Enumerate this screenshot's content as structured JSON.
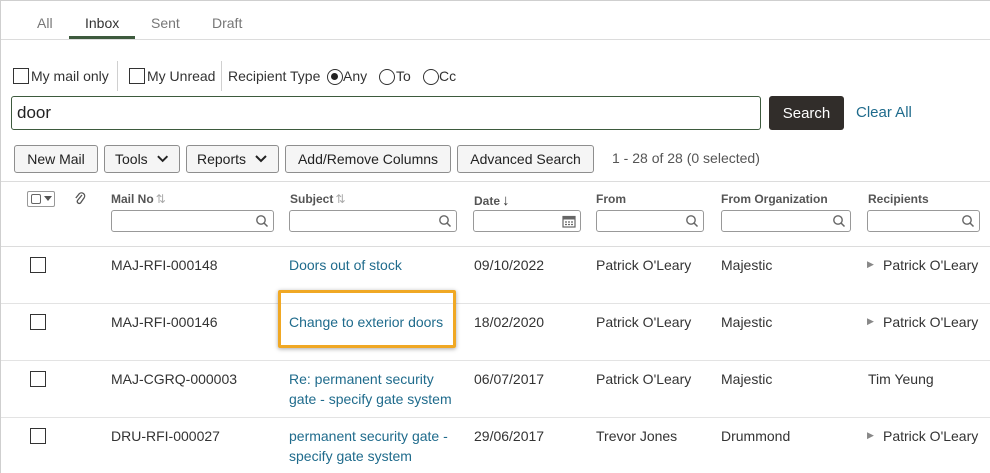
{
  "tabs": [
    "All",
    "Inbox",
    "Sent",
    "Draft"
  ],
  "filters": {
    "my_mail_only": "My mail only",
    "my_unread": "My Unread",
    "recipient_type": "Recipient Type",
    "any": "Any",
    "to": "To",
    "cc": "Cc",
    "selected_recipient": "Any"
  },
  "search": {
    "value": "door",
    "button": "Search",
    "clear_all": "Clear All"
  },
  "toolbar": {
    "new_mail": "New Mail",
    "tools": "Tools",
    "reports": "Reports",
    "add_remove_columns": "Add/Remove Columns",
    "advanced_search": "Advanced Search",
    "result_count": "1 - 28 of 28 (0 selected)"
  },
  "columns": {
    "mail_no": "Mail No",
    "subject": "Subject",
    "date": "Date",
    "from": "From",
    "from_org": "From Organization",
    "recipients": "Recipients"
  },
  "rows": [
    {
      "mail_no": "MAJ-RFI-000148",
      "subject_1": "Doors out of stock",
      "subject_2": "",
      "date": "09/10/2022",
      "from": "Patrick O'Leary",
      "org": "Majestic",
      "recipients": "Patrick O'Leary",
      "expandable": true
    },
    {
      "mail_no": "MAJ-RFI-000146",
      "subject_1": "Change to exterior doors",
      "subject_2": "",
      "date": "18/02/2020",
      "from": "Patrick O'Leary",
      "org": "Majestic",
      "recipients": "Patrick O'Leary",
      "expandable": true
    },
    {
      "mail_no": "MAJ-CGRQ-000003",
      "subject_1": "Re: permanent security",
      "subject_2": "gate - specify gate system",
      "date": "06/07/2017",
      "from": "Patrick O'Leary",
      "org": "Majestic",
      "recipients": "Tim Yeung",
      "expandable": false
    },
    {
      "mail_no": "DRU-RFI-000027",
      "subject_1": "permanent security gate -",
      "subject_2": "specify gate system",
      "date": "29/06/2017",
      "from": "Trevor Jones",
      "org": "Drummond",
      "recipients": "Patrick O'Leary",
      "expandable": true
    }
  ],
  "colors": {
    "accent_green": "#3d5a3d",
    "link": "#1f6b8c",
    "highlight": "#f0a824",
    "search_button": "#312d2a"
  }
}
